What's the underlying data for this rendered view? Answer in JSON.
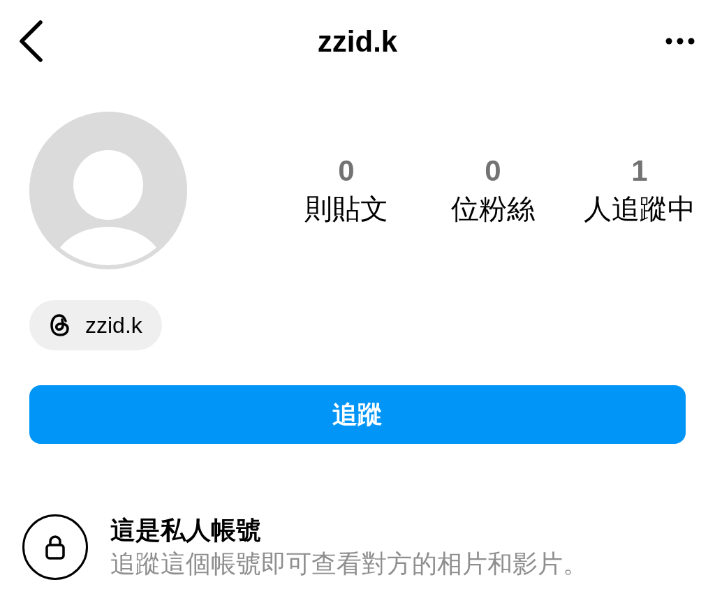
{
  "header": {
    "title": "zzid.k"
  },
  "stats": [
    {
      "count": "0",
      "label": "則貼文"
    },
    {
      "count": "0",
      "label": "位粉絲"
    },
    {
      "count": "1",
      "label": "人追蹤中"
    }
  ],
  "threads_badge": {
    "handle": "zzid.k"
  },
  "follow_button": {
    "label": "追蹤"
  },
  "private_notice": {
    "title": "這是私人帳號",
    "subtitle": "追蹤這個帳號即可查看對方的相片和影片。"
  }
}
